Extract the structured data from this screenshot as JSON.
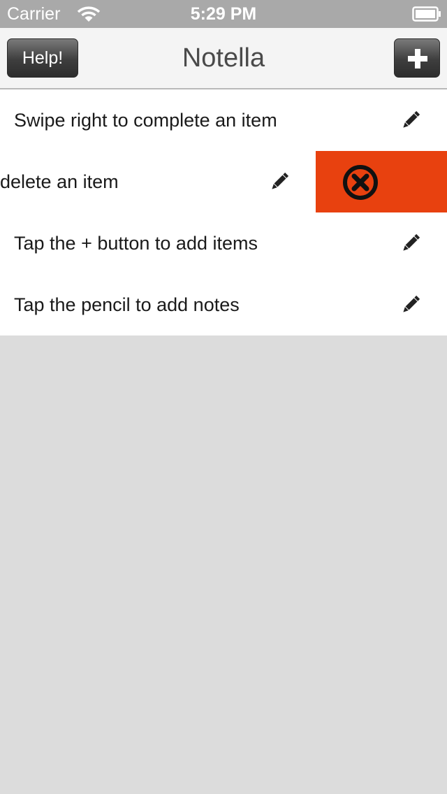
{
  "status_bar": {
    "carrier": "Carrier",
    "time": "5:29 PM"
  },
  "nav": {
    "help_label": "Help!",
    "title": "Notella",
    "add_icon": "plus-icon"
  },
  "items": [
    {
      "label": "Swipe right to complete an item",
      "icon": "pencil-icon"
    },
    {
      "label": "delete an item",
      "icon": "pencil-icon",
      "swiped_action": "delete",
      "action_icon": "x-circle-icon"
    },
    {
      "label": "Tap the + button to add items",
      "icon": "pencil-icon"
    },
    {
      "label": "Tap the pencil to add notes",
      "icon": "pencil-icon"
    }
  ],
  "colors": {
    "delete_action": "#e8410f",
    "status_bar": "#a9a9a9",
    "background": "#dcdcdc"
  }
}
